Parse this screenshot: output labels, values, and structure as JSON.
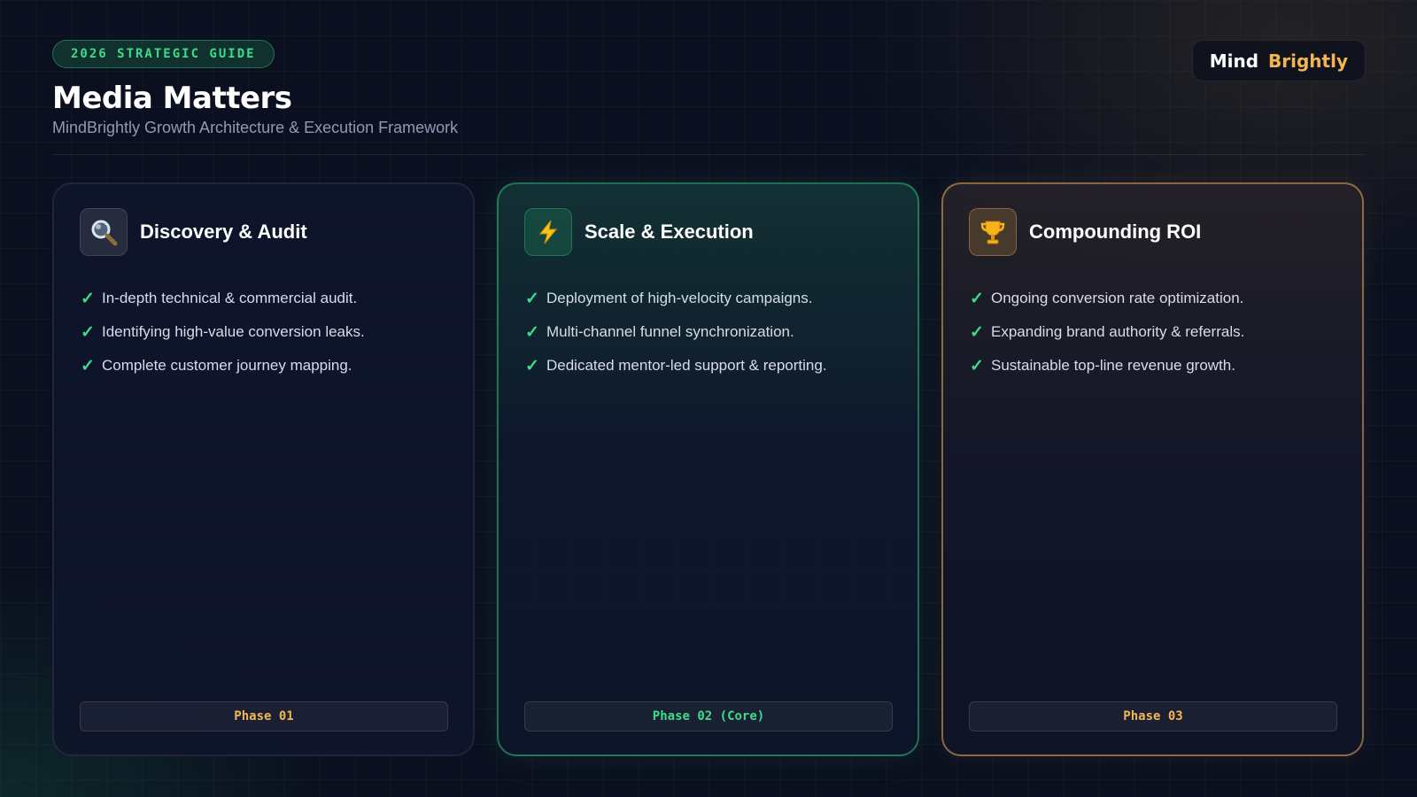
{
  "header": {
    "badge": "2026 STRATEGIC GUIDE",
    "title": "Media Matters",
    "subtitle": "MindBrightly Growth Architecture & Execution Framework"
  },
  "logo": {
    "part1": "Mind",
    "part2": "Brightly"
  },
  "colors": {
    "accent_green": "#3ddc8b",
    "accent_gold": "#f2b552",
    "background": "#0b1020"
  },
  "cards": [
    {
      "icon": "magnifying-glass-icon",
      "title": "Discovery & Audit",
      "items": [
        "In-depth technical & commercial audit.",
        "Identifying high-value conversion leaks.",
        "Complete customer journey mapping."
      ],
      "phase": "Phase 01"
    },
    {
      "icon": "lightning-bolt-icon",
      "title": "Scale & Execution",
      "items": [
        "Deployment of high-velocity campaigns.",
        "Multi-channel funnel synchronization.",
        "Dedicated mentor-led support & reporting."
      ],
      "phase": "Phase 02 (Core)"
    },
    {
      "icon": "trophy-icon",
      "title": "Compounding ROI",
      "items": [
        "Ongoing conversion rate optimization.",
        "Expanding brand authority & referrals.",
        "Sustainable top-line revenue growth."
      ],
      "phase": "Phase 03"
    }
  ]
}
